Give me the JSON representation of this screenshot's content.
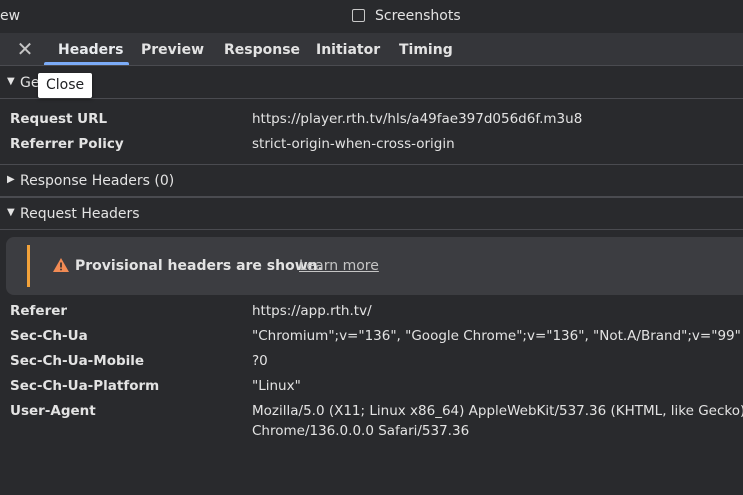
{
  "topbar": {
    "cut_text": "ew",
    "screenshots_label": "Screenshots"
  },
  "tabs": {
    "close_tooltip": "Close",
    "items": [
      "Headers",
      "Preview",
      "Response",
      "Initiator",
      "Timing"
    ]
  },
  "general": {
    "title": "Ge",
    "rows": [
      {
        "key": "Request URL",
        "value": "https://player.rth.tv/hls/a49fae397d056d6f.m3u8"
      },
      {
        "key": "Referrer Policy",
        "value": "strict-origin-when-cross-origin"
      }
    ]
  },
  "response_headers": {
    "title": "Response Headers (0)"
  },
  "request_headers": {
    "title": "Request Headers",
    "warning": "Provisional headers are shown.",
    "learn_more": "Learn more",
    "rows": [
      {
        "key": "Referer",
        "value": "https://app.rth.tv/"
      },
      {
        "key": "Sec-Ch-Ua",
        "value": "\"Chromium\";v=\"136\", \"Google Chrome\";v=\"136\", \"Not.A/Brand\";v=\"99\""
      },
      {
        "key": "Sec-Ch-Ua-Mobile",
        "value": "?0"
      },
      {
        "key": "Sec-Ch-Ua-Platform",
        "value": "\"Linux\""
      },
      {
        "key": "User-Agent",
        "value": "Mozilla/5.0 (X11; Linux x86_64) AppleWebKit/537.36 (KHTML, like Gecko)",
        "value2": "Chrome/136.0.0.0 Safari/537.36"
      }
    ]
  },
  "colors": {
    "accent": "#7cacf8",
    "warning": "#f2a23a",
    "bg": "#292a2d"
  }
}
